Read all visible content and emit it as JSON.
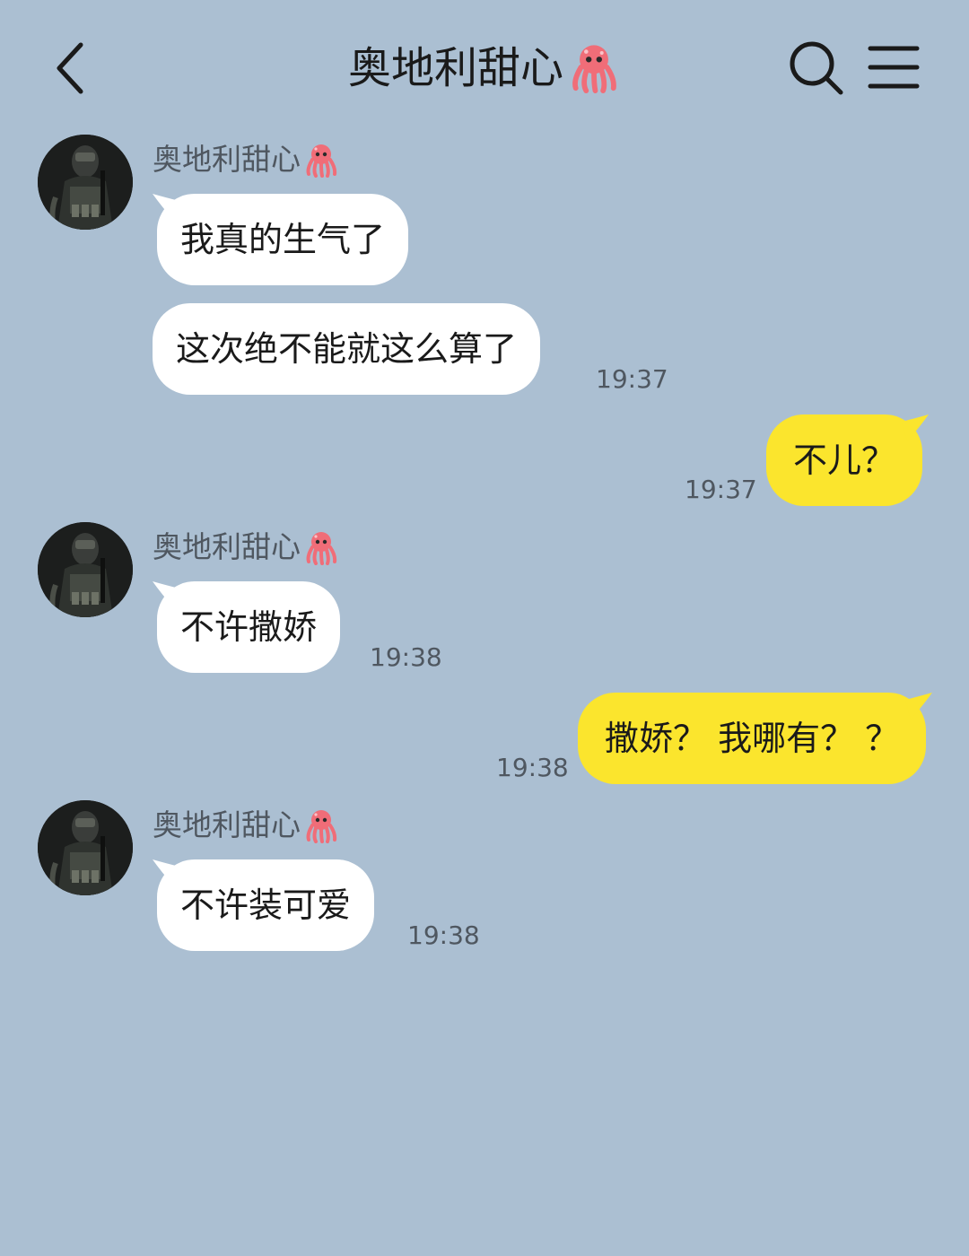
{
  "header": {
    "title": "奥地利甜心",
    "title_emoji": "octopus-emoji",
    "back_icon": "chevron-left-icon",
    "search_icon": "search-icon",
    "menu_icon": "menu-icon"
  },
  "colors": {
    "background": "#abbfd2",
    "incoming_bubble": "#ffffff",
    "outgoing_bubble": "#fbe52d",
    "timestamp": "#4f5760"
  },
  "messages": [
    {
      "direction": "incoming",
      "sender": "奥地利甜心",
      "text": "我真的生气了",
      "time": ""
    },
    {
      "direction": "incoming",
      "sender": "",
      "text": "这次绝不能就这么算了",
      "time": "19:37"
    },
    {
      "direction": "outgoing",
      "text": "不儿？",
      "time": "19:37"
    },
    {
      "direction": "incoming",
      "sender": "奥地利甜心",
      "text": "不许撒娇",
      "time": "19:38"
    },
    {
      "direction": "outgoing",
      "text": "撒娇？ 我哪有？ ？",
      "time": "19:38"
    },
    {
      "direction": "incoming",
      "sender": "奥地利甜心",
      "text": "不许装可爱",
      "time": "19:38"
    }
  ]
}
